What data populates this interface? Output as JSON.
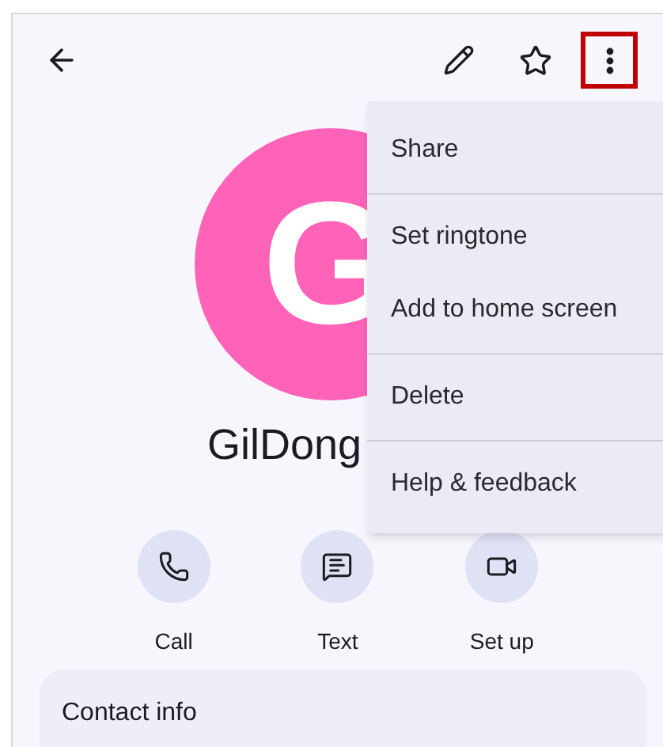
{
  "toolbar": {
    "more_highlighted": true
  },
  "avatar": {
    "letter": "G"
  },
  "name_lines": [
    "GilDong"
  ],
  "menu": [
    {
      "label": "Share",
      "divider_after": true
    },
    {
      "label": "Set ringtone",
      "divider_after": false
    },
    {
      "label": "Add to home screen",
      "divider_after": true
    },
    {
      "label": "Delete",
      "divider_after": true
    },
    {
      "label": "Help & feedback",
      "divider_after": false
    }
  ],
  "actions": [
    {
      "kind": "call",
      "label": "Call"
    },
    {
      "kind": "text",
      "label": "Text"
    },
    {
      "kind": "video",
      "label": "Set up"
    }
  ],
  "card": {
    "title": "Contact info"
  }
}
